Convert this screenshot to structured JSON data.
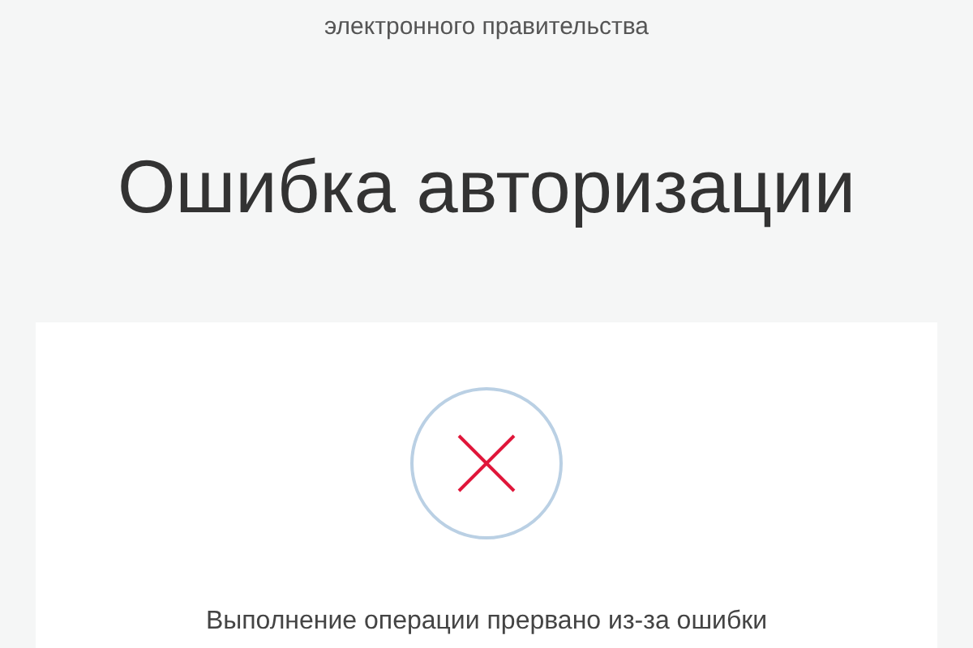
{
  "header": {
    "subtitle": "электронного правительства"
  },
  "title": "Ошибка авторизации",
  "card": {
    "kind": "error",
    "message": "Выполнение операции прервано из-за ошибки"
  }
}
